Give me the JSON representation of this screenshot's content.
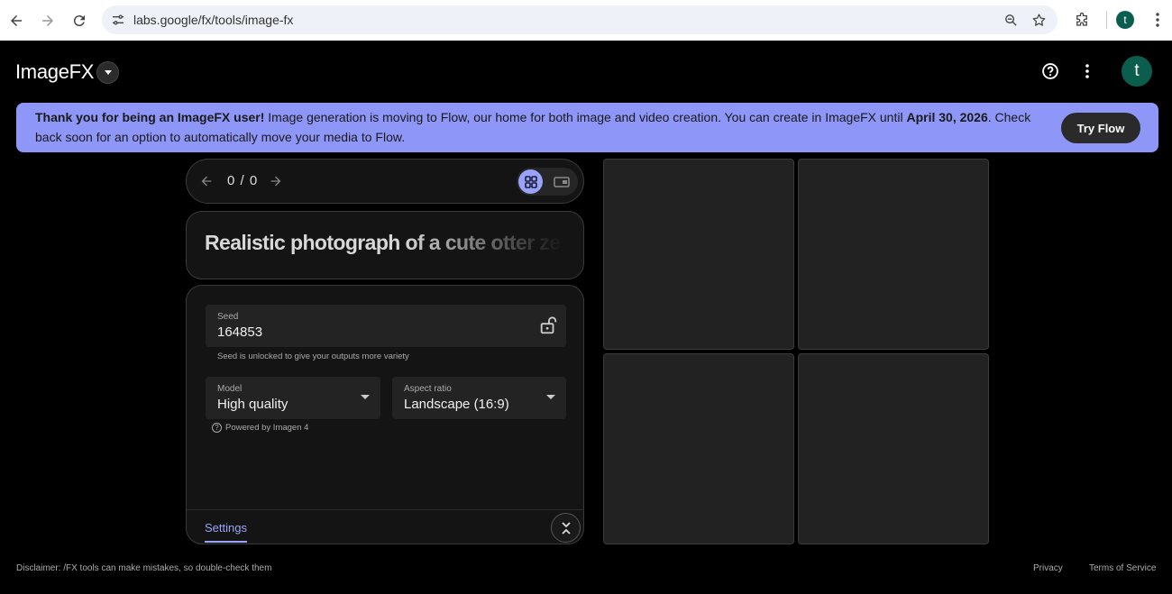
{
  "browser": {
    "url": "labs.google/fx/tools/image-fx",
    "profile_initial": "t",
    "icons": [
      "back-icon",
      "forward-icon",
      "reload-icon",
      "site-info-icon",
      "zoom-icon",
      "bookmark-star-icon",
      "extensions-icon",
      "more-vert-icon"
    ]
  },
  "header": {
    "logo": "ImageFX",
    "avatar_initial": "t"
  },
  "banner": {
    "bold_lead": "Thank you for being an ImageFX user!",
    "text_mid": " Image generation is moving to Flow, our home for both image and video creation. You can create in ImageFX until ",
    "bold_date": "April 30, 2026",
    "text_end": ". Check back soon for an option to automatically move your media to Flow.",
    "cta": "Try Flow"
  },
  "pager": {
    "count": "0 / 0"
  },
  "prompt": {
    "text": "Realistic photograph of a cute otter ze"
  },
  "settings": {
    "seed_label": "Seed",
    "seed_value": "164853",
    "seed_hint": "Seed is unlocked to give your outputs more variety",
    "model_label": "Model",
    "model_value": "High quality",
    "aspect_label": "Aspect ratio",
    "aspect_value": "Landscape (16:9)",
    "powered_by": "Powered by Imagen 4",
    "tab_label": "Settings"
  },
  "footer": {
    "disclaimer": "Disclaimer: /FX tools can make mistakes, so double-check them",
    "privacy": "Privacy",
    "terms": "Terms of Service"
  },
  "colors": {
    "banner_bg": "#8e96f8",
    "accent": "#9aa3fa",
    "avatar_bg": "#0b5e4e"
  }
}
